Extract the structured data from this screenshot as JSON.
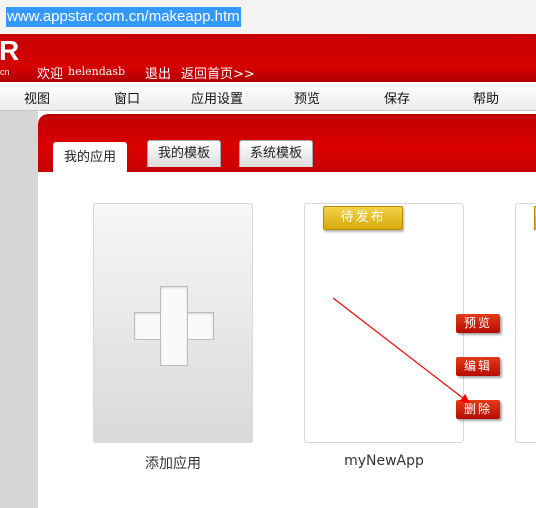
{
  "browser": {
    "url": "www.appstar.com.cn/makeapp.htm"
  },
  "header": {
    "logo_letter": "R",
    "logo_suffix": "cn",
    "welcome": "欢迎",
    "username": "helendasb",
    "logout": "退出",
    "home": "返回首页>>"
  },
  "menu": {
    "items": [
      "视图",
      "窗口",
      "应用设置",
      "预览",
      "保存",
      "帮助"
    ]
  },
  "tabs": [
    {
      "label": "我的应用",
      "active": true
    },
    {
      "label": "我的模板",
      "active": false
    },
    {
      "label": "系统模板",
      "active": false
    }
  ],
  "cards": {
    "add": {
      "caption": "添加应用"
    },
    "app": {
      "name": "myNewApp",
      "status": "待发布",
      "actions": [
        "预览",
        "编辑",
        "删除"
      ]
    }
  },
  "colors": {
    "header_red": "#d60000",
    "badge_gold": "#e2b819",
    "action_red": "#c81e0b",
    "url_highlight": "#3399ff",
    "annotation_arrow": "#ff0000"
  }
}
